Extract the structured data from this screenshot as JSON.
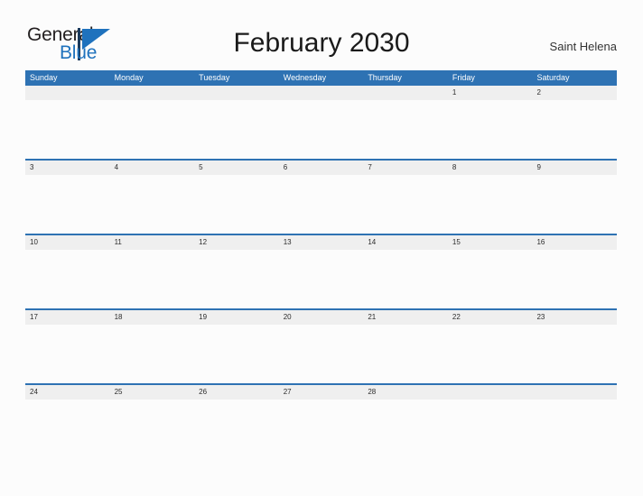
{
  "logo": {
    "word_one": "General",
    "word_two": "Blue",
    "triangle_color": "#1f72bd",
    "text_color": "#231f20"
  },
  "header": {
    "title": "February 2030",
    "region": "Saint Helena"
  },
  "theme": {
    "header_blue": "#2e72b3",
    "date_band_gray": "#efefef",
    "page_background": "#fcfcfc",
    "text_dark": "#2b2b2b",
    "header_text": "#ffffff"
  },
  "calendar": {
    "month": "February",
    "year": "2030",
    "weekday_headers": [
      "Sunday",
      "Monday",
      "Tuesday",
      "Wednesday",
      "Thursday",
      "Friday",
      "Saturday"
    ],
    "weeks": [
      {
        "days": [
          "",
          "",
          "",
          "",
          "",
          "1",
          "2"
        ],
        "events": [
          "",
          "",
          "",
          "",
          "",
          "",
          ""
        ]
      },
      {
        "days": [
          "3",
          "4",
          "5",
          "6",
          "7",
          "8",
          "9"
        ],
        "events": [
          "",
          "",
          "",
          "",
          "",
          "",
          ""
        ]
      },
      {
        "days": [
          "10",
          "11",
          "12",
          "13",
          "14",
          "15",
          "16"
        ],
        "events": [
          "",
          "",
          "",
          "",
          "",
          "",
          ""
        ]
      },
      {
        "days": [
          "17",
          "18",
          "19",
          "20",
          "21",
          "22",
          "23"
        ],
        "events": [
          "",
          "",
          "",
          "",
          "",
          "",
          ""
        ]
      },
      {
        "days": [
          "24",
          "25",
          "26",
          "27",
          "28",
          "",
          ""
        ],
        "events": [
          "",
          "",
          "",
          "",
          "",
          "",
          ""
        ]
      }
    ]
  }
}
